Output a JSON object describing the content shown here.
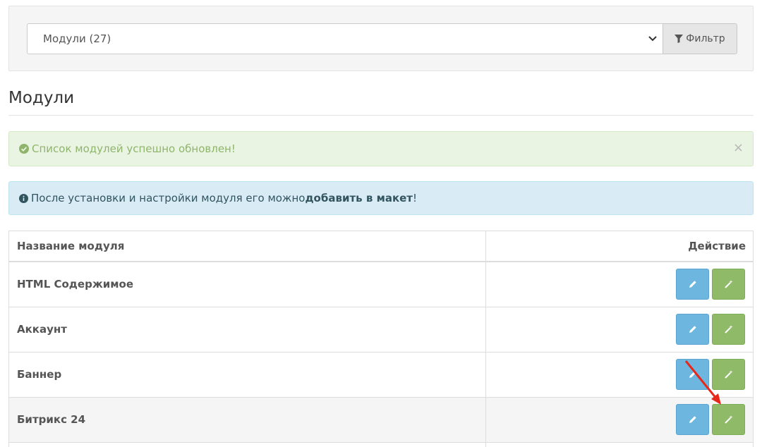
{
  "filter": {
    "selected_value": "Модули (27)",
    "button_label": "Фильтр"
  },
  "page": {
    "title": "Модули"
  },
  "alerts": {
    "success_text": "Список модулей успешно обновлен!",
    "close_glyph": "×",
    "info_prefix": "После установки и настройки модуля его можно ",
    "info_link": "добавить в макет",
    "info_suffix": "!"
  },
  "table": {
    "columns": [
      "Название модуля",
      "Действие"
    ],
    "rows": [
      {
        "name": "HTML Содержимое"
      },
      {
        "name": "Аккаунт"
      },
      {
        "name": "Баннер"
      },
      {
        "name": "Битрикс 24"
      }
    ]
  },
  "icons": {
    "filter": "filter-icon",
    "select": "chevron-down-icon",
    "success": "check-circle-icon",
    "info": "info-circle-icon",
    "edit": "pencil-icon",
    "install": "magic-wand-icon"
  },
  "colors": {
    "edit_button": "#6cb6df",
    "install_button": "#8fbb68",
    "annotation_arrow": "#e8271b"
  }
}
